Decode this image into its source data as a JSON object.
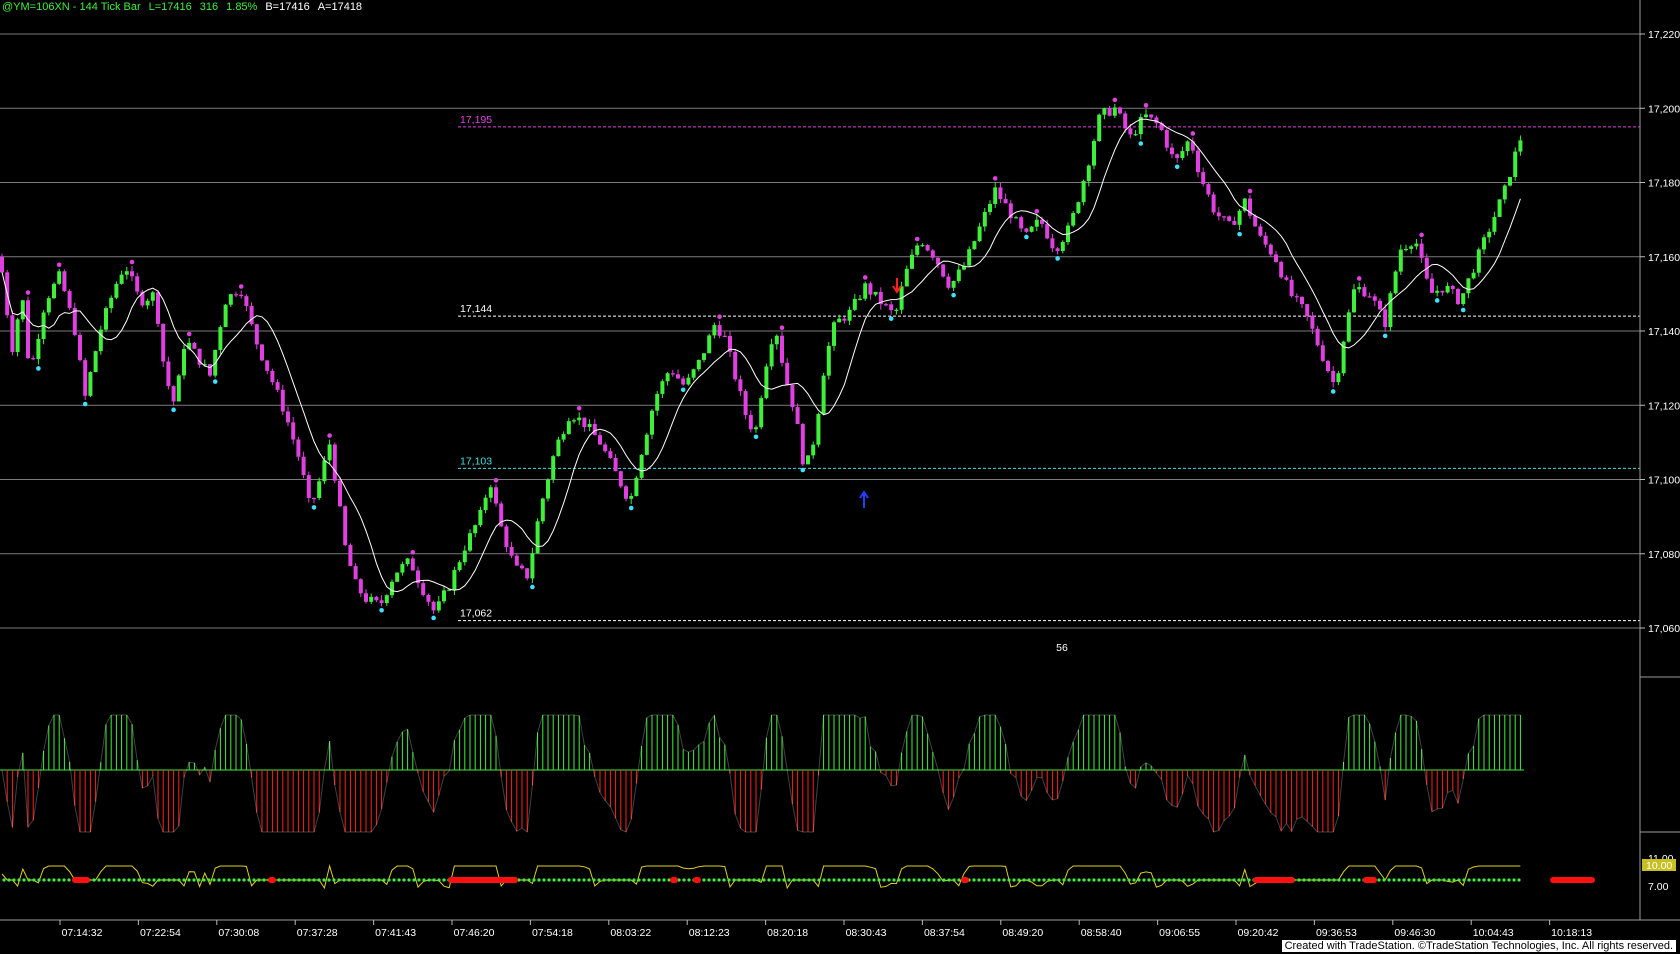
{
  "header": {
    "symbol": "@YM=106XN - 144 Tick Bar",
    "last": "L=17416",
    "change": "316",
    "pct": "1.85%",
    "bid": "B=17416",
    "ask": "A=17418"
  },
  "footer": {
    "text": "Created with TradeStation. ©TradeStation Technologies, Inc. All rights reserved."
  },
  "chart_data": {
    "type": "candlestick",
    "y_ticks": [
      "17,220",
      "17,200",
      "17,180",
      "17,160",
      "17,140",
      "17,120",
      "17,100",
      "17,080",
      "17,060"
    ],
    "ylim": [
      17060,
      17224
    ],
    "x_ticks": [
      "07:14:32",
      "07:22:54",
      "07:30:08",
      "07:37:28",
      "07:41:43",
      "07:46:20",
      "07:54:18",
      "08:03:22",
      "08:12:23",
      "08:20:18",
      "08:30:43",
      "08:37:54",
      "08:49:20",
      "08:58:40",
      "09:06:55",
      "09:20:42",
      "09:36:53",
      "09:46:30",
      "10:04:43",
      "10:18:13"
    ],
    "levels": [
      {
        "label": "17,195",
        "value": 17195,
        "color": "#e040e0"
      },
      {
        "label": "17,144",
        "value": 17144,
        "color": "#ffffff"
      },
      {
        "label": "17,103",
        "value": 17103,
        "color": "#40e0e0"
      },
      {
        "label": "17,062",
        "value": 17062,
        "color": "#ffffff"
      }
    ],
    "price_path": [
      [
        0,
        17160
      ],
      [
        12,
        17135
      ],
      [
        22,
        17150
      ],
      [
        30,
        17128
      ],
      [
        45,
        17148
      ],
      [
        60,
        17155
      ],
      [
        75,
        17140
      ],
      [
        85,
        17122
      ],
      [
        100,
        17140
      ],
      [
        115,
        17152
      ],
      [
        125,
        17158
      ],
      [
        140,
        17148
      ],
      [
        155,
        17150
      ],
      [
        165,
        17128
      ],
      [
        175,
        17120
      ],
      [
        185,
        17138
      ],
      [
        200,
        17132
      ],
      [
        210,
        17128
      ],
      [
        225,
        17148
      ],
      [
        240,
        17152
      ],
      [
        255,
        17138
      ],
      [
        270,
        17128
      ],
      [
        285,
        17118
      ],
      [
        300,
        17105
      ],
      [
        310,
        17092
      ],
      [
        320,
        17100
      ],
      [
        330,
        17110
      ],
      [
        345,
        17082
      ],
      [
        355,
        17072
      ],
      [
        365,
        17068
      ],
      [
        380,
        17066
      ],
      [
        395,
        17075
      ],
      [
        410,
        17078
      ],
      [
        420,
        17072
      ],
      [
        435,
        17064
      ],
      [
        450,
        17072
      ],
      [
        465,
        17082
      ],
      [
        480,
        17090
      ],
      [
        490,
        17100
      ],
      [
        500,
        17088
      ],
      [
        515,
        17076
      ],
      [
        528,
        17074
      ],
      [
        540,
        17092
      ],
      [
        555,
        17108
      ],
      [
        570,
        17118
      ],
      [
        585,
        17115
      ],
      [
        600,
        17110
      ],
      [
        615,
        17102
      ],
      [
        630,
        17094
      ],
      [
        640,
        17106
      ],
      [
        655,
        17122
      ],
      [
        670,
        17130
      ],
      [
        685,
        17125
      ],
      [
        700,
        17132
      ],
      [
        715,
        17142
      ],
      [
        725,
        17138
      ],
      [
        735,
        17128
      ],
      [
        745,
        17118
      ],
      [
        755,
        17112
      ],
      [
        765,
        17130
      ],
      [
        775,
        17142
      ],
      [
        785,
        17128
      ],
      [
        795,
        17118
      ],
      [
        805,
        17102
      ],
      [
        815,
        17112
      ],
      [
        825,
        17132
      ],
      [
        835,
        17142
      ],
      [
        850,
        17145
      ],
      [
        865,
        17152
      ],
      [
        880,
        17148
      ],
      [
        895,
        17144
      ],
      [
        905,
        17155
      ],
      [
        920,
        17165
      ],
      [
        935,
        17160
      ],
      [
        950,
        17152
      ],
      [
        965,
        17158
      ],
      [
        980,
        17168
      ],
      [
        995,
        17178
      ],
      [
        1010,
        17172
      ],
      [
        1025,
        17165
      ],
      [
        1040,
        17170
      ],
      [
        1055,
        17162
      ],
      [
        1070,
        17168
      ],
      [
        1085,
        17182
      ],
      [
        1100,
        17198
      ],
      [
        1115,
        17200
      ],
      [
        1130,
        17192
      ],
      [
        1145,
        17198
      ],
      [
        1160,
        17195
      ],
      [
        1175,
        17185
      ],
      [
        1190,
        17192
      ],
      [
        1200,
        17182
      ],
      [
        1215,
        17172
      ],
      [
        1230,
        17168
      ],
      [
        1245,
        17175
      ],
      [
        1260,
        17165
      ],
      [
        1275,
        17160
      ],
      [
        1290,
        17150
      ],
      [
        1305,
        17145
      ],
      [
        1320,
        17135
      ],
      [
        1335,
        17125
      ],
      [
        1345,
        17140
      ],
      [
        1355,
        17152
      ],
      [
        1370,
        17150
      ],
      [
        1385,
        17142
      ],
      [
        1400,
        17162
      ],
      [
        1415,
        17165
      ],
      [
        1430,
        17150
      ],
      [
        1445,
        17152
      ],
      [
        1460,
        17148
      ],
      [
        1475,
        17158
      ],
      [
        1490,
        17168
      ],
      [
        1505,
        17178
      ],
      [
        1520,
        17192
      ],
      [
        1524,
        17190
      ]
    ],
    "indicator": "oscillator histogram",
    "lower_y_ticks": [
      "11.00",
      "10.00",
      "7.00"
    ],
    "annotation_count": "56"
  },
  "colors": {
    "up": "#3ef03a",
    "down": "#e040e0",
    "ma": "#ffffff",
    "pivot_high": "#e040e0",
    "pivot_low": "#3ee0ff",
    "hist_up": "#3ef03a",
    "hist_down": "#ff2020"
  }
}
